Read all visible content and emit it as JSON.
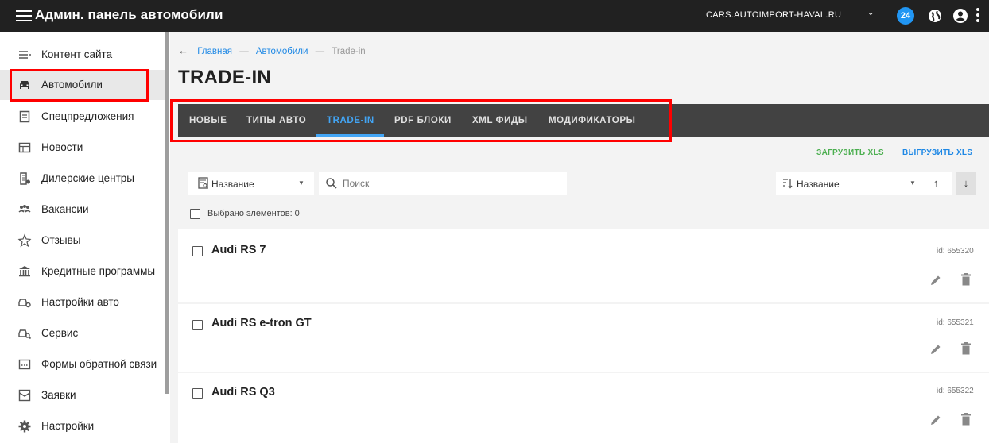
{
  "app": {
    "title": "Админ. панель автомобили",
    "domain": "CARS.AUTOIMPORT-HAVAL.RU",
    "notifications_count": "24"
  },
  "sidebar": {
    "items": [
      {
        "label": "Контент сайта",
        "icon": "content-list-icon"
      },
      {
        "label": "Автомобили",
        "icon": "car-icon"
      },
      {
        "label": "Спецпредложения",
        "icon": "document-icon"
      },
      {
        "label": "Новости",
        "icon": "news-icon"
      },
      {
        "label": "Дилерские центры",
        "icon": "dealer-building-icon"
      },
      {
        "label": "Вакансии",
        "icon": "people-icon"
      },
      {
        "label": "Отзывы",
        "icon": "stars-icon"
      },
      {
        "label": "Кредитные программы",
        "icon": "bank-icon"
      },
      {
        "label": "Настройки авто",
        "icon": "car-settings-icon"
      },
      {
        "label": "Сервис",
        "icon": "car-service-icon"
      },
      {
        "label": "Формы обратной связи",
        "icon": "form-icon"
      },
      {
        "label": "Заявки",
        "icon": "inbox-icon"
      },
      {
        "label": "Настройки",
        "icon": "gear-icon"
      }
    ],
    "active_index": 1
  },
  "breadcrumb": {
    "items": [
      "Главная",
      "Автомобили",
      "Trade-in"
    ],
    "separator": "—"
  },
  "page": {
    "title": "TRADE-IN"
  },
  "tabs": {
    "items": [
      "НОВЫЕ",
      "ТИПЫ АВТО",
      "TRADE-IN",
      "PDF БЛОКИ",
      "XML ФИДЫ",
      "МОДИФИКАТОРЫ"
    ],
    "active": "TRADE-IN"
  },
  "toolbar": {
    "upload_label": "ЗАГРУЗИТЬ XLS",
    "download_label": "ВЫГРУЗИТЬ XLS",
    "filter_label": "Название",
    "search_placeholder": "Поиск",
    "sort_label": "Название",
    "selected_label": "Выбрано элементов: 0"
  },
  "items": [
    {
      "title": "Audi RS 7",
      "id": "id: 655320"
    },
    {
      "title": "Audi RS e-tron GT",
      "id": "id: 655321"
    },
    {
      "title": "Audi RS Q3",
      "id": "id: 655322"
    }
  ],
  "colors": {
    "topbar": "#212121",
    "tabs_bg": "#424242",
    "accent_blue": "#42a5f5",
    "upload_green": "#4caf50",
    "highlight_red": "#ff0000"
  }
}
